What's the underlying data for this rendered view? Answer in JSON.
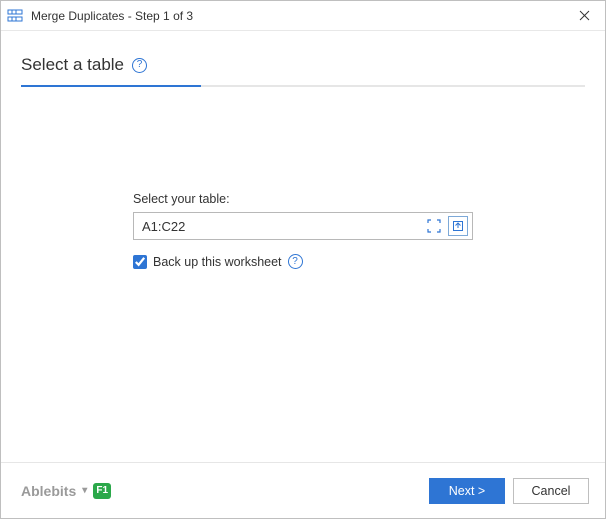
{
  "titlebar": {
    "title": "Merge Duplicates - Step 1 of 3"
  },
  "header": {
    "title": "Select a table"
  },
  "form": {
    "field_label": "Select your table:",
    "range_value": "A1:C22",
    "backup_label": "Back up this worksheet"
  },
  "footer": {
    "brand": "Ablebits",
    "f1": "F1",
    "next": "Next >",
    "cancel": "Cancel"
  }
}
